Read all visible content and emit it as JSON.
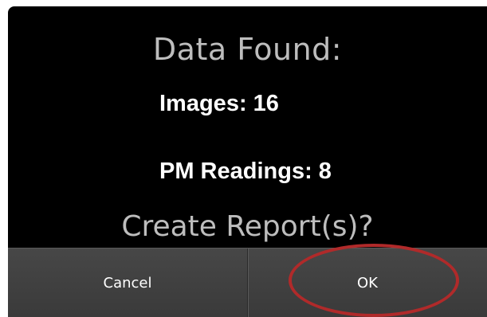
{
  "dialog": {
    "title": "Data Found:",
    "images_label": "Images: 16",
    "pm_readings_label": "PM Readings: 8",
    "question": "Create Report(s)?"
  },
  "buttons": {
    "cancel_label": "Cancel",
    "ok_label": "OK"
  },
  "colors": {
    "dialog_background": "#000000",
    "title_text": "#bdbdbd",
    "stat_text": "#ffffff",
    "button_bar": "#404040",
    "highlight_ring": "#b02a2a"
  }
}
